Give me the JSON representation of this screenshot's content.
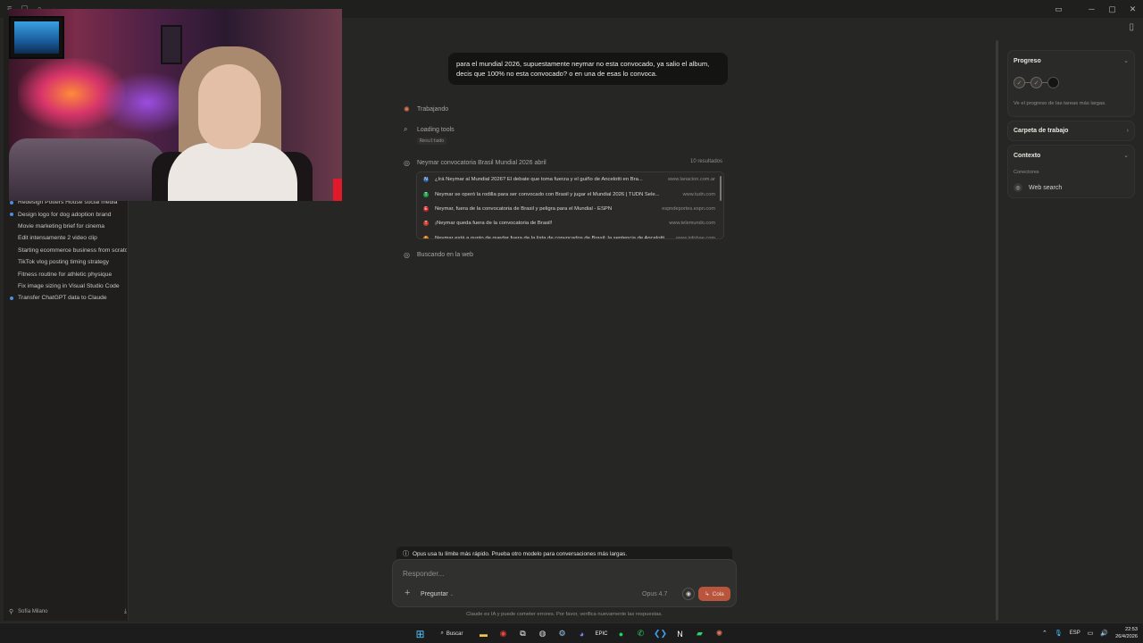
{
  "sidebar": {
    "recents": [
      {
        "label": "Redesign Potters House social media",
        "dot": true
      },
      {
        "label": "Design logo for dog adoption brand",
        "dot": true
      },
      {
        "label": "Movie marketing brief for cinema",
        "dot": false
      },
      {
        "label": "Edit intensamente 2 video clip",
        "dot": false
      },
      {
        "label": "Starting ecommerce business from scratch",
        "dot": false
      },
      {
        "label": "TikTok vlog posting timing strategy",
        "dot": false
      },
      {
        "label": "Fitness routine for athletic physique",
        "dot": false
      },
      {
        "label": "Fix image sizing in Visual Studio Code",
        "dot": false
      },
      {
        "label": "Transfer ChatGPT data to Claude",
        "dot": true
      }
    ],
    "user_name": "Sofía Milano"
  },
  "chat": {
    "user_message": "para el mundial 2026, supuestamente neymar no esta convocado, ya salio el album, decis que 100% no esta convocado? o en una de esas lo convoca.",
    "status_working": "Trabajando",
    "step_loading": "Loading tools",
    "resultado_tag": "Resultado",
    "search_query": "Neymar convocatoria Brasil Mundial 2026 abril",
    "search_count": "10 resultados",
    "results": [
      {
        "title": "¿Irá Neymar al Mundial 2026? El debate que toma fuerza y el guiño de Ancelotti en Bra...",
        "domain": "www.lanacion.com.ar",
        "color": "#2a5fa8",
        "icon": "N"
      },
      {
        "title": "Neymar se operó la rodilla para ser convocado con Brasil y jugar el Mundial 2026 | TUDN Sele...",
        "domain": "www.tudn.com",
        "color": "#1a9b4a",
        "icon": "T"
      },
      {
        "title": "Neymar, fuera de la convocatoria de Brasil y peligra para el Mundial - ESPN",
        "domain": "espndeportes.espn.com",
        "color": "#d0242a",
        "icon": "E"
      },
      {
        "title": "¡Neymar queda fuera de la convocatoria de Brasil!",
        "domain": "www.telemundo.com",
        "color": "#c73a2a",
        "icon": "T"
      },
      {
        "title": "Neymar está a punto de quedar fuera de la lista de convocados de Brasil: la sentencia de Ancelotti",
        "domain": "www.infobae.com",
        "color": "#e07a1a",
        "icon": "I"
      }
    ],
    "step_searching": "Buscando en la web",
    "notice": "Opus usa tu límite más rápido. Prueba otro modelo para conversaciones más largas.",
    "composer_placeholder": "Responder...",
    "mode_label": "Preguntar",
    "model_label": "Opus 4.7",
    "send_label": "Cola",
    "disclaimer": "Claude es IA y puede cometer errores. Por favor, verifica nuevamente las respuestas."
  },
  "right_panel": {
    "progress_title": "Progreso",
    "progress_sub": "Ve el progreso de las tareas más largas.",
    "folder_title": "Carpeta de trabajo",
    "context_title": "Contexto",
    "connectors_label": "Conectores",
    "web_search_label": "Web search"
  },
  "taskbar": {
    "search_label": "Buscar",
    "lang": "ESP",
    "time": "22:53",
    "date": "26/4/2026"
  },
  "colors": {
    "accent": "#d97757",
    "send_button": "#b8553c",
    "background": "#262624"
  }
}
